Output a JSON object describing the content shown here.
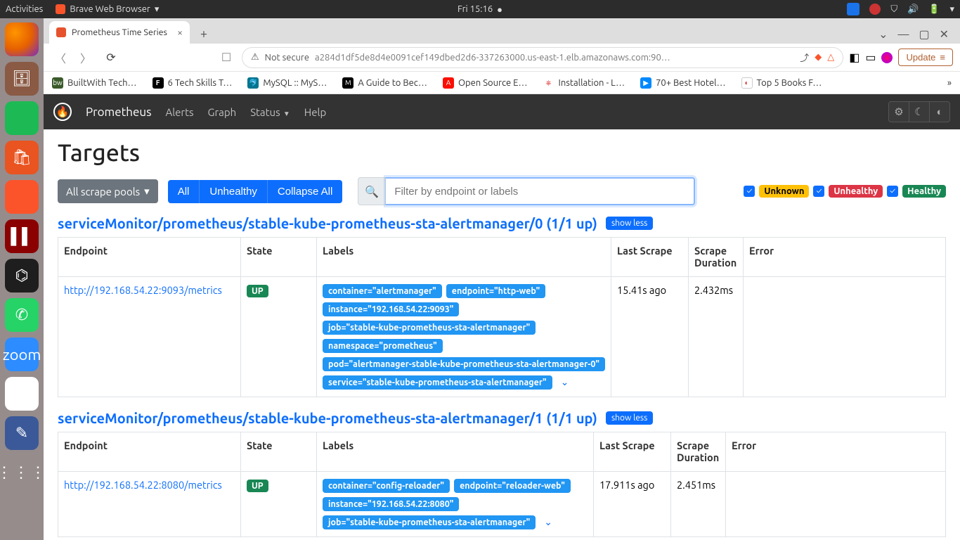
{
  "desktop": {
    "activities": "Activities",
    "app": "Brave Web Browser",
    "clock": "Fri 15:16"
  },
  "tab": {
    "title": "Prometheus Time Series"
  },
  "addr": {
    "not_secure": "Not secure",
    "url": "a284d1df5de8d4e0091cef149dbed2d6-337263000.us-east-1.elb.amazonaws.com:90…",
    "update": "Update"
  },
  "bookmarks": [
    "BuiltWith Tech…",
    "6 Tech Skills T…",
    "MySQL :: MyS…",
    "A Guide to Bec…",
    "Open Source E…",
    "Installation - L…",
    "70+ Best Hotel…",
    "Top 5 Books F…"
  ],
  "prom": {
    "brand": "Prometheus",
    "nav": {
      "alerts": "Alerts",
      "graph": "Graph",
      "status": "Status",
      "help": "Help"
    }
  },
  "page": {
    "title": "Targets",
    "pools": "All scrape pools",
    "all": "All",
    "unhealthy": "Unhealthy",
    "collapse": "Collapse All",
    "filter_ph": "Filter by endpoint or labels",
    "chips": {
      "unknown": "Unknown",
      "unhealthy": "Unhealthy",
      "healthy": "Healthy"
    },
    "showless": "show less",
    "cols": {
      "endpoint": "Endpoint",
      "state": "State",
      "labels": "Labels",
      "last": "Last Scrape",
      "dur": "Scrape Duration",
      "error": "Error"
    }
  },
  "groups": [
    {
      "title": "serviceMonitor/prometheus/stable-kube-prometheus-sta-alertmanager/0 (1/1 up)",
      "rows": [
        {
          "endpoint": "http://192.168.54.22:9093/metrics",
          "state": "UP",
          "last": "15.41s ago",
          "dur": "2.432ms",
          "labels": [
            "container=\"alertmanager\"",
            "endpoint=\"http-web\"",
            "instance=\"192.168.54.22:9093\"",
            "job=\"stable-kube-prometheus-sta-alertmanager\"",
            "namespace=\"prometheus\"",
            "pod=\"alertmanager-stable-kube-prometheus-sta-alertmanager-0\"",
            "service=\"stable-kube-prometheus-sta-alertmanager\""
          ]
        }
      ]
    },
    {
      "title": "serviceMonitor/prometheus/stable-kube-prometheus-sta-alertmanager/1 (1/1 up)",
      "rows": [
        {
          "endpoint": "http://192.168.54.22:8080/metrics",
          "state": "UP",
          "last": "17.911s ago",
          "dur": "2.451ms",
          "labels": [
            "container=\"config-reloader\"",
            "endpoint=\"reloader-web\"",
            "instance=\"192.168.54.22:8080\"",
            "job=\"stable-kube-prometheus-sta-alertmanager\""
          ]
        }
      ]
    }
  ]
}
